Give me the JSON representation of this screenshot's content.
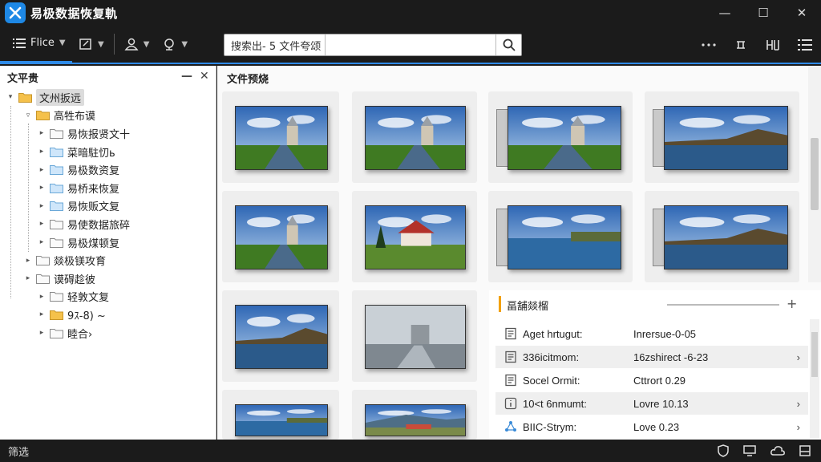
{
  "app": {
    "title": "易极数据恢复軌",
    "logo_color": "#1e88e5"
  },
  "window_controls": {
    "minimize": "—",
    "maximize": "☐",
    "close": "✕"
  },
  "toolbar": {
    "file_label": "Flice",
    "search": {
      "value": "搜索出- 5 文件夸颂",
      "placeholder": "搜索"
    },
    "accent_color": "#2f8be8"
  },
  "left_panel": {
    "title": "文平贵",
    "collapse": "—",
    "close": "✕",
    "tree": [
      {
        "label": "文州扳远",
        "level": 0,
        "arrow": "▾",
        "folder": "yellow",
        "selected": true
      },
      {
        "label": "高牲布谟",
        "level": 1,
        "arrow": "▿",
        "folder": "yellow"
      },
      {
        "label": "易恢报贤文十",
        "level": 2,
        "arrow": "▸",
        "folder": "outline"
      },
      {
        "label": "菜暗駐忉ь",
        "level": 2,
        "arrow": "▸",
        "folder": "blue"
      },
      {
        "label": "易极数资复",
        "level": 2,
        "arrow": "▸",
        "folder": "blue"
      },
      {
        "label": "易桥来恢复",
        "level": 2,
        "arrow": "▸",
        "folder": "blue"
      },
      {
        "label": "易恢贩文复",
        "level": 2,
        "arrow": "▸",
        "folder": "blue"
      },
      {
        "label": "易使数据旅碎",
        "level": 2,
        "arrow": "▸",
        "folder": "outline"
      },
      {
        "label": "易极煤顿复",
        "level": 2,
        "arrow": "▸",
        "folder": "outline"
      },
      {
        "label": "燚极镁攻育",
        "level": 1,
        "arrow": "▸",
        "folder": "outline"
      },
      {
        "label": "谟碍趁彼",
        "level": 1,
        "arrow": "▸",
        "folder": "outline"
      },
      {
        "label": "轻敦文复",
        "level": 2,
        "arrow": "▸",
        "folder": "outline"
      },
      {
        "label": "9ｽ-8) ~",
        "level": 2,
        "arrow": "▸",
        "folder": "yellow"
      },
      {
        "label": "睦合›",
        "level": 2,
        "arrow": "▸",
        "folder": "outline"
      }
    ]
  },
  "main": {
    "title": "文件预烧"
  },
  "properties": {
    "title": "畐舖燚榴",
    "plus": "+",
    "rows": [
      {
        "name": "Aget hrtugut:",
        "value": "Inrersue-0-05",
        "icon": "document-icon",
        "chevron": ""
      },
      {
        "name": "336icitmom:",
        "value": "16zshirect  -6-23",
        "icon": "document-icon",
        "chevron": "›"
      },
      {
        "name": "Socel Ormit:",
        "value": "Cttrort  0.29",
        "icon": "document-icon",
        "chevron": ""
      },
      {
        "name": "10<t 6nmumt:",
        "value": "Lovre  10.13",
        "icon": "info-icon",
        "chevron": "›"
      },
      {
        "name": "BIIC-Strym:",
        "value": "Love  0.23",
        "icon": "network-icon",
        "chevron": "›"
      }
    ]
  },
  "status": {
    "text": "筛选"
  }
}
